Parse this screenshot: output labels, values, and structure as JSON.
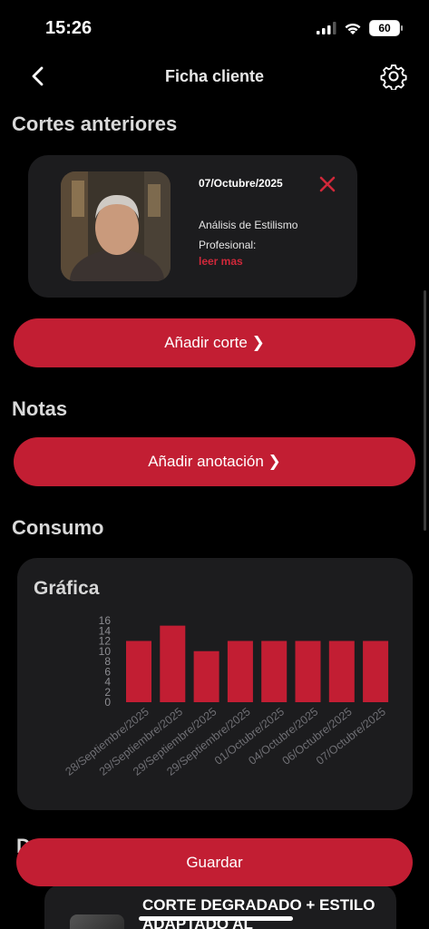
{
  "status_bar": {
    "time": "15:26",
    "battery": "60"
  },
  "nav": {
    "title": "Ficha cliente"
  },
  "sections": {
    "cortes": "Cortes anteriores",
    "notas": "Notas",
    "consumo": "Consumo"
  },
  "cut_card": {
    "date": "07/Octubre/2025",
    "description": "Análisis de Estilismo Profesional:",
    "read_more": "leer mas"
  },
  "buttons": {
    "add_cut": "Añadir corte ❯",
    "add_note": "Añadir anotación ❯",
    "save": "Guardar"
  },
  "colors": {
    "accent": "#c21e33",
    "card": "#1c1c1e",
    "background": "#000000"
  },
  "chart_data": {
    "type": "bar",
    "title": "Gráfica",
    "categories": [
      "28/Septiembre/2025",
      "29/Septiembre/2025",
      "29/Septiembre/2025",
      "29/Septiembre/2025",
      "01/Octubre/2025",
      "04/Octubre/2025",
      "06/Octubre/2025",
      "07/Octubre/2025"
    ],
    "values": [
      12,
      15,
      10,
      12,
      12,
      12,
      12,
      12
    ],
    "yticks": [
      "0",
      "2",
      "4",
      "6",
      "8",
      "10",
      "12",
      "14",
      "16"
    ],
    "ylim": [
      0,
      16
    ],
    "color": "#c21e33"
  },
  "preview_card": {
    "title": "CORTE DEGRADADO + ESTILO ADAPTADO AL"
  },
  "icons": {
    "back": "chevron-left-icon",
    "settings": "gear-icon",
    "delete": "close-icon",
    "wifi": "wifi-icon",
    "signal": "signal-icon"
  }
}
